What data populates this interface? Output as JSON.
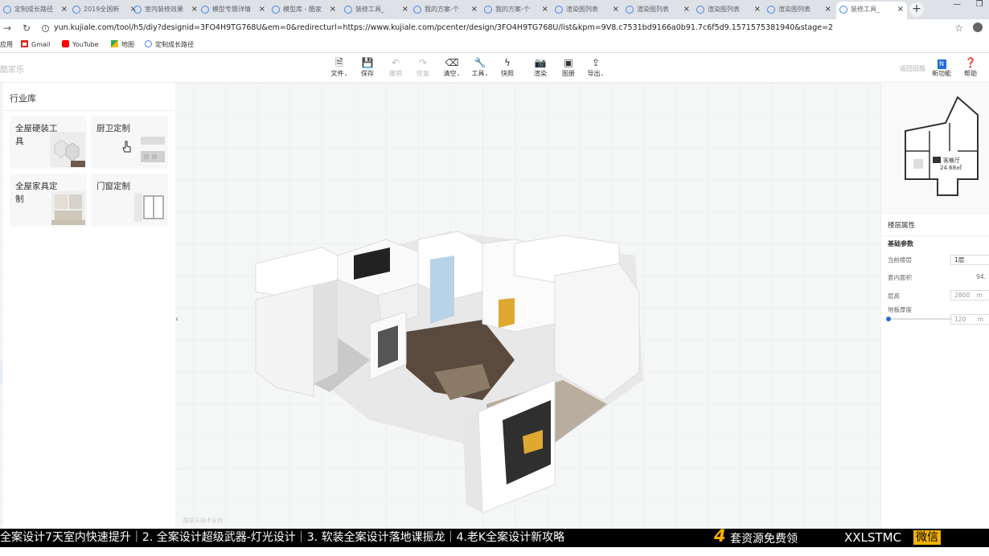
{
  "browser": {
    "tabs": [
      {
        "title": "定制成长路径"
      },
      {
        "title": "2019全国新"
      },
      {
        "title": "室内装修效果"
      },
      {
        "title": "模型专题详情"
      },
      {
        "title": "模型库 - 酷家"
      },
      {
        "title": "装修工具_"
      },
      {
        "title": "我的方案-个"
      },
      {
        "title": "我的方案-个"
      },
      {
        "title": "渲染图列表"
      },
      {
        "title": "渲染图列表"
      },
      {
        "title": "渲染图列表"
      },
      {
        "title": "渲染图列表"
      },
      {
        "title": "装修工具_"
      }
    ],
    "url": "yun.kujiale.com/tool/h5/diy?designid=3FO4H9TG768U&em=0&redirecturl=https://www.kujiale.com/pcenter/design/3FO4H9TG768U/list&kpm=9V8.c7531bd9166a0b91.7c6f5d9.1571575381940&stage=2",
    "bookmarks": [
      {
        "label": "应用",
        "icon": "apps-icon"
      },
      {
        "label": "Gmail",
        "icon": "gmail-icon",
        "color": "#d93025"
      },
      {
        "label": "YouTube",
        "icon": "youtube-icon",
        "color": "#ff0000"
      },
      {
        "label": "地图",
        "icon": "maps-icon"
      },
      {
        "label": "定制成长路径",
        "icon": "site-icon"
      }
    ]
  },
  "app": {
    "logo": "酷家乐",
    "toolbar": [
      {
        "label": "文件",
        "icon": "file-icon",
        "enabled": true
      },
      {
        "label": "保存",
        "icon": "save-icon",
        "enabled": true
      },
      {
        "label": "撤销",
        "icon": "undo-icon",
        "enabled": false
      },
      {
        "label": "恢复",
        "icon": "redo-icon",
        "enabled": false
      },
      {
        "label": "清空",
        "icon": "eraser-icon",
        "enabled": true
      },
      {
        "label": "工具",
        "icon": "wrench-icon",
        "enabled": true
      },
      {
        "label": "快照",
        "icon": "lightning-icon",
        "enabled": true
      },
      {
        "label": "渲染",
        "icon": "camera-icon",
        "enabled": true
      },
      {
        "label": "图册",
        "icon": "album-icon",
        "enabled": true
      },
      {
        "label": "导出",
        "icon": "export-icon",
        "enabled": true
      }
    ],
    "back_old": "返回旧版",
    "new_feature": "新功能",
    "help": "帮助"
  },
  "left_panel": {
    "title": "行业库",
    "cards": [
      {
        "label": "全屋硬装工具"
      },
      {
        "label": "厨卫定制"
      },
      {
        "label": "全屋家具定制"
      },
      {
        "label": "门窗定制"
      }
    ]
  },
  "right_panel": {
    "minimap_room_label": "客餐厅",
    "minimap_room_area": "24.68㎡",
    "section_title": "楼层属性",
    "subsection": "基础参数",
    "current_floor_label": "当前楼层",
    "current_floor_value": "1层",
    "area_label": "套内面积",
    "area_value": "94.",
    "height_label": "层高",
    "height_value": "2800",
    "height_unit": "m",
    "slab_label": "地板厚度",
    "slab_value": "120",
    "slab_unit": "m",
    "slab_level": 0.0
  },
  "viewport": {
    "watermark": "酷家乐技术支持"
  },
  "banner": {
    "text": "全案设计7天室内快速提升｜2. 全案设计超级武器-灯光设计｜3. 软装全案设计落地课振龙｜4.老K全案设计新攻略",
    "number": "4",
    "free_text": "套资源免费领",
    "wechat_id": "XXLSTMC",
    "wechat_tag": "微信"
  },
  "colors": {
    "accent": "#1e6fd9",
    "banner_bg": "#000000",
    "banner_highlight": "#f5b300",
    "viewport_bg": "#f5f6f6"
  }
}
